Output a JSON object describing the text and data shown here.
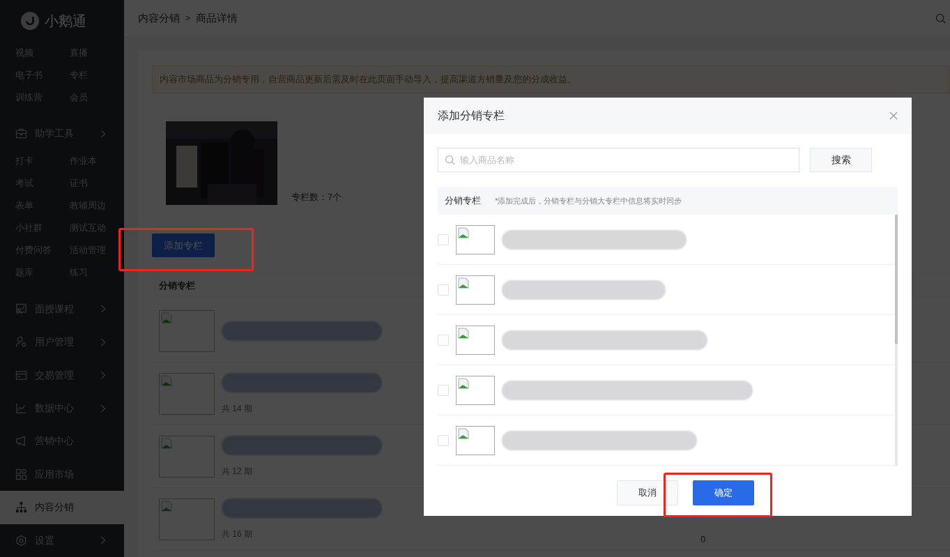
{
  "sidebar": {
    "logo": "小鹅通",
    "sections": [
      {
        "kind": "links",
        "links": [
          "视频",
          "直播",
          "电子书",
          "专栏",
          "训练营",
          "会员"
        ]
      },
      {
        "kind": "menu",
        "label": "助学工具",
        "has_arrow": true,
        "selected": false
      },
      {
        "kind": "links",
        "links": [
          "打卡",
          "作业本",
          "考试",
          "证书",
          "表单",
          "教辅周边",
          "小社群",
          "测试互动",
          "付费问答",
          "活动管理",
          "题库",
          "练习"
        ]
      },
      {
        "kind": "menu",
        "label": "面授课程",
        "has_arrow": true,
        "selected": false
      },
      {
        "kind": "menu",
        "label": "用户管理",
        "has_arrow": true,
        "selected": false
      },
      {
        "kind": "menu",
        "label": "交易管理",
        "has_arrow": true,
        "selected": false
      },
      {
        "kind": "menu",
        "label": "数据中心",
        "has_arrow": true,
        "selected": false
      },
      {
        "kind": "menu",
        "label": "营销中心",
        "has_arrow": false,
        "selected": false
      },
      {
        "kind": "menu",
        "label": "应用市场",
        "has_arrow": false,
        "selected": false
      },
      {
        "kind": "menu",
        "label": "内容分销",
        "has_arrow": false,
        "selected": true
      },
      {
        "kind": "menu",
        "label": "设置",
        "has_arrow": true,
        "selected": false
      }
    ]
  },
  "breadcrumb": [
    "内容分销",
    "商品详情"
  ],
  "breadcrumb_separator": ">",
  "notice": "内容市场商品为分销专用，自营商品更新后需及时在此页面手动导入，提高渠道方销量及您的分成收益。",
  "product": {
    "column_count": "专栏数：7个"
  },
  "add_button": "添加专栏",
  "columns_table": {
    "heading": "分销专栏",
    "rows": [
      {},
      {
        "issues": "共 14 期"
      },
      {
        "issues": "共 12 期"
      },
      {
        "issues": "共 16 期",
        "count": "0"
      }
    ]
  },
  "dialog": {
    "title": "添加分销专栏",
    "search": {
      "placeholder": "输入商品名称",
      "button": "搜索"
    },
    "list_heading": "分销专栏",
    "list_note": "*添加完成后，分销专栏与分销大专栏中信息将实时同步",
    "rows": [
      {
        "checked": false
      },
      {
        "checked": false
      },
      {
        "checked": false
      },
      {
        "checked": false
      },
      {
        "checked": false
      }
    ],
    "buttons": [
      {
        "label": "取消",
        "kind": "secondary"
      },
      {
        "label": "确定",
        "kind": "primary"
      }
    ]
  }
}
